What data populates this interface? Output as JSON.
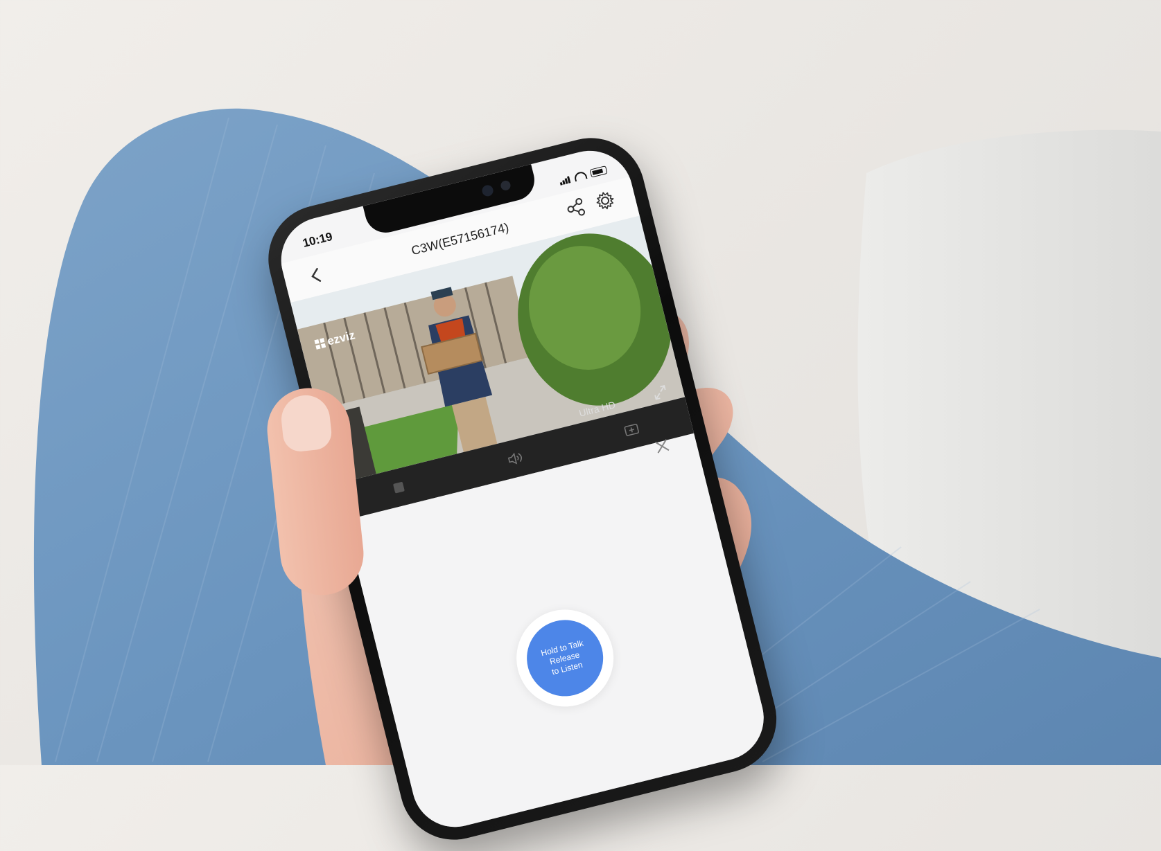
{
  "status_bar": {
    "time": "10:19"
  },
  "header": {
    "title": "C3W(E57156174)",
    "icons": {
      "back": "chevron-left-icon",
      "share": "share-icon",
      "settings": "gear-icon"
    }
  },
  "video": {
    "brand": "ezviz",
    "quality_label": "Ultra HD",
    "icons": {
      "fullscreen": "expand-icon"
    }
  },
  "toolbar": {
    "items": [
      {
        "icon": "record-icon"
      },
      {
        "icon": "speaker-icon"
      },
      {
        "icon": "screenshot-icon"
      }
    ]
  },
  "talk": {
    "line1": "Hold to Talk",
    "line2": "Release",
    "line3": "to Listen",
    "close_icon": "close-icon",
    "accent_color": "#4d86e8"
  }
}
